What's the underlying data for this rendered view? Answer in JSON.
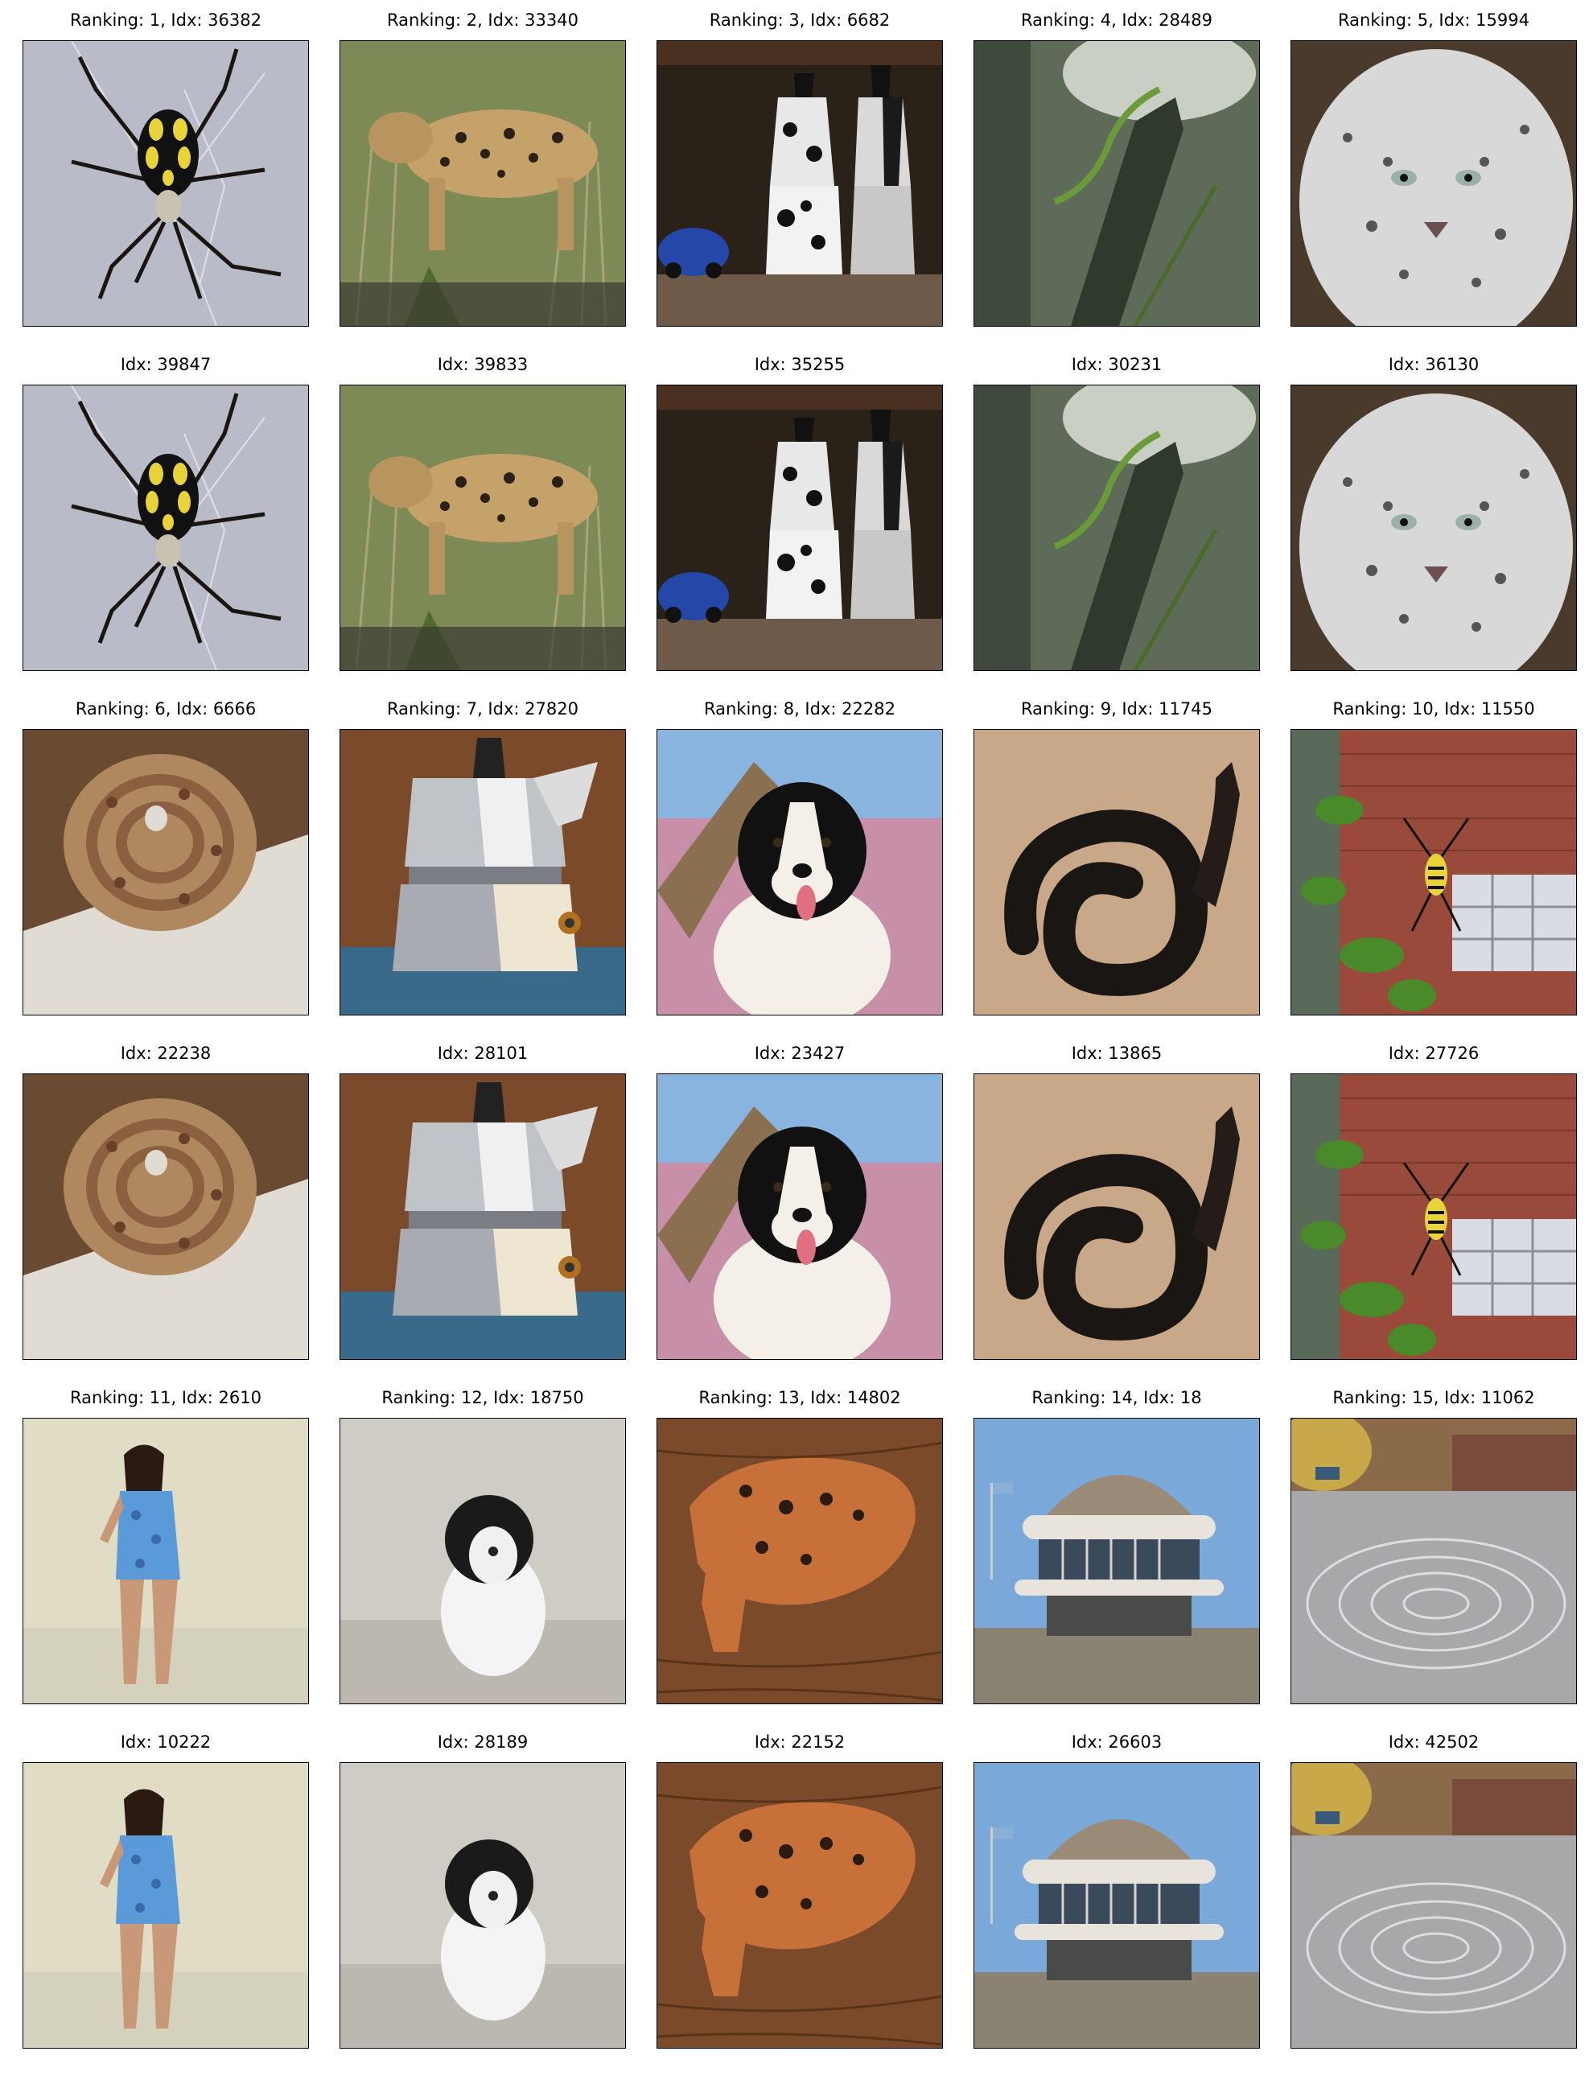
{
  "rows": [
    {
      "kind": "query",
      "cells": [
        {
          "title": "Ranking: 1, Idx: 36382",
          "subject": "spider"
        },
        {
          "title": "Ranking: 2, Idx: 33340",
          "subject": "leopard"
        },
        {
          "title": "Ranking: 3, Idx: 6682",
          "subject": "coffee-pots"
        },
        {
          "title": "Ranking: 4, Idx: 28489",
          "subject": "chameleon-branch"
        },
        {
          "title": "Ranking: 5, Idx: 15994",
          "subject": "snow-leopard"
        }
      ]
    },
    {
      "kind": "match",
      "cells": [
        {
          "title": "Idx: 39847",
          "subject": "spider"
        },
        {
          "title": "Idx: 39833",
          "subject": "leopard"
        },
        {
          "title": "Idx: 35255",
          "subject": "coffee-pots"
        },
        {
          "title": "Idx: 30231",
          "subject": "chameleon-branch"
        },
        {
          "title": "Idx: 36130",
          "subject": "snow-leopard"
        }
      ]
    },
    {
      "kind": "query",
      "cells": [
        {
          "title": "Ranking: 6, Idx: 6666",
          "subject": "rattlesnake"
        },
        {
          "title": "Ranking: 7, Idx: 27820",
          "subject": "moka-pot"
        },
        {
          "title": "Ranking: 8, Idx: 22282",
          "subject": "border-collie"
        },
        {
          "title": "Ranking: 9, Idx: 11745",
          "subject": "black-snake"
        },
        {
          "title": "Ranking: 10, Idx: 11550",
          "subject": "garden-spider"
        }
      ]
    },
    {
      "kind": "match",
      "cells": [
        {
          "title": "Idx: 22238",
          "subject": "rattlesnake"
        },
        {
          "title": "Idx: 28101",
          "subject": "moka-pot"
        },
        {
          "title": "Idx: 23427",
          "subject": "border-collie"
        },
        {
          "title": "Idx: 13865",
          "subject": "black-snake"
        },
        {
          "title": "Idx: 27726",
          "subject": "garden-spider"
        }
      ]
    },
    {
      "kind": "query",
      "cells": [
        {
          "title": "Ranking: 11, Idx: 2610",
          "subject": "woman"
        },
        {
          "title": "Ranking: 12, Idx: 18750",
          "subject": "puppy"
        },
        {
          "title": "Ranking: 13, Idx: 14802",
          "subject": "ocarina"
        },
        {
          "title": "Ranking: 14, Idx: 18",
          "subject": "planetarium"
        },
        {
          "title": "Ranking: 15, Idx: 11062",
          "subject": "chalk-spiral"
        }
      ]
    },
    {
      "kind": "match",
      "cells": [
        {
          "title": "Idx: 10222",
          "subject": "woman"
        },
        {
          "title": "Idx: 28189",
          "subject": "puppy"
        },
        {
          "title": "Idx: 22152",
          "subject": "ocarina"
        },
        {
          "title": "Idx: 26603",
          "subject": "planetarium"
        },
        {
          "title": "Idx: 42502",
          "subject": "chalk-spiral"
        }
      ]
    }
  ]
}
